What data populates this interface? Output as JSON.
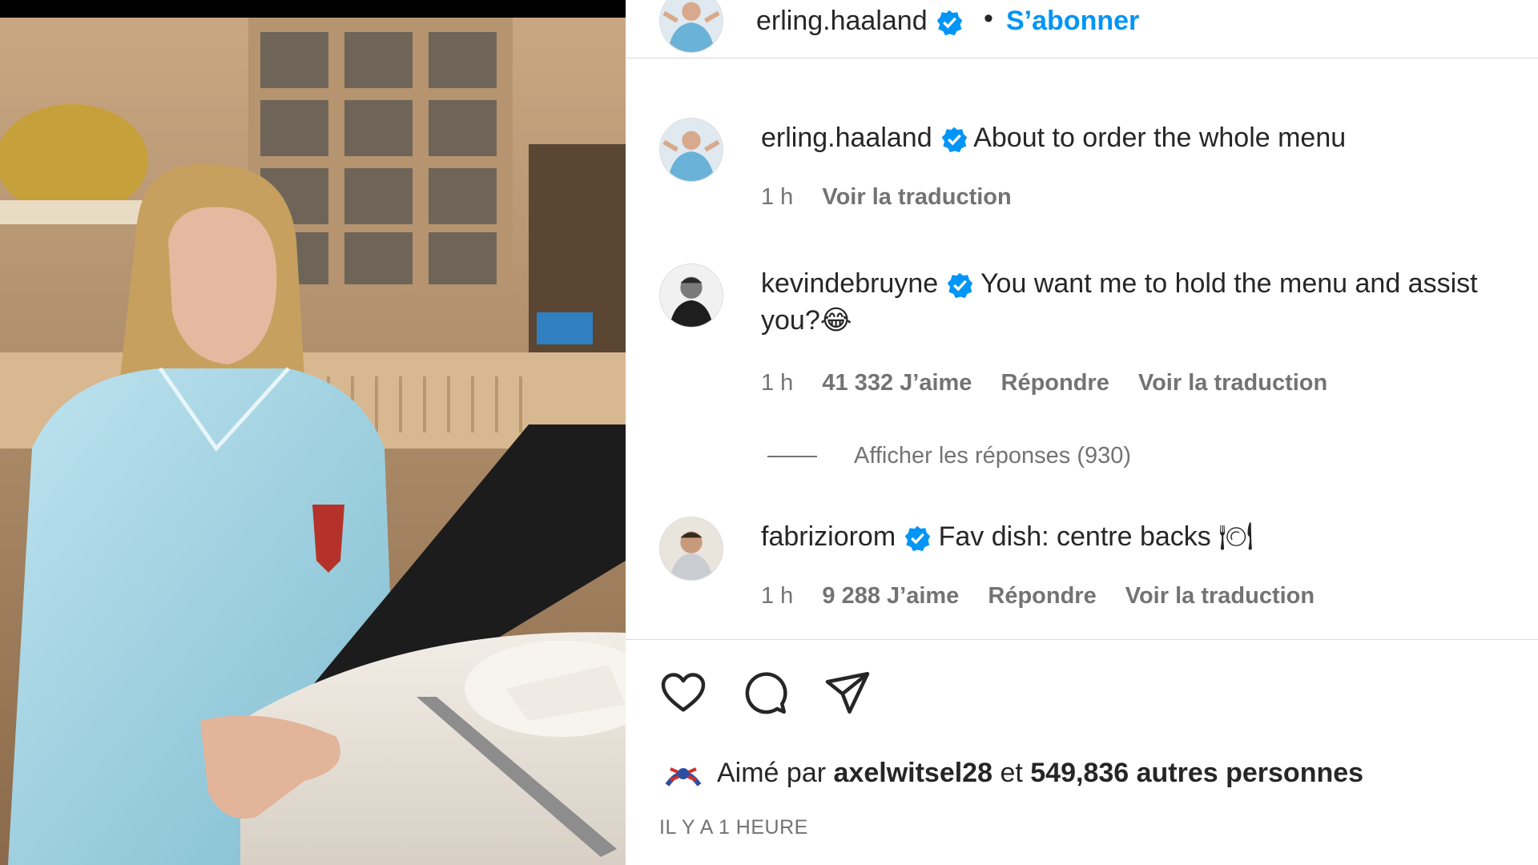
{
  "header": {
    "username": "erling.haaland",
    "separator": "•",
    "follow_label": "S’abonner"
  },
  "comments": [
    {
      "username": "erling.haaland",
      "text": "About to order the whole menu",
      "time": "1 h",
      "translate": "Voir la traduction"
    },
    {
      "username": "kevindebruyne",
      "text": "You want me to hold the menu and assist you?😂",
      "time": "1 h",
      "likes": "41 332 J’aime",
      "reply": "Répondre",
      "translate": "Voir la traduction",
      "view_replies": "Afficher les réponses (930)"
    },
    {
      "username": "fabriziorom",
      "text": "Fav dish: centre backs 🍽",
      "time": "1 h",
      "likes": "9 288 J’aime",
      "reply": "Répondre",
      "translate": "Voir la traduction"
    }
  ],
  "actions": {
    "like_icon": "heart-icon",
    "comment_icon": "speech-bubble-icon",
    "share_icon": "paper-plane-icon"
  },
  "likes": {
    "prefix": "Aimé par",
    "user": "axelwitsel28",
    "middle": "et",
    "others": "549,836 autres personnes"
  },
  "timestamp": "IL Y A 1 HEURE",
  "colors": {
    "accent": "#0095f6",
    "verified": "#0095f6",
    "secondary_text": "#737373",
    "divider": "#dbdbdb"
  }
}
